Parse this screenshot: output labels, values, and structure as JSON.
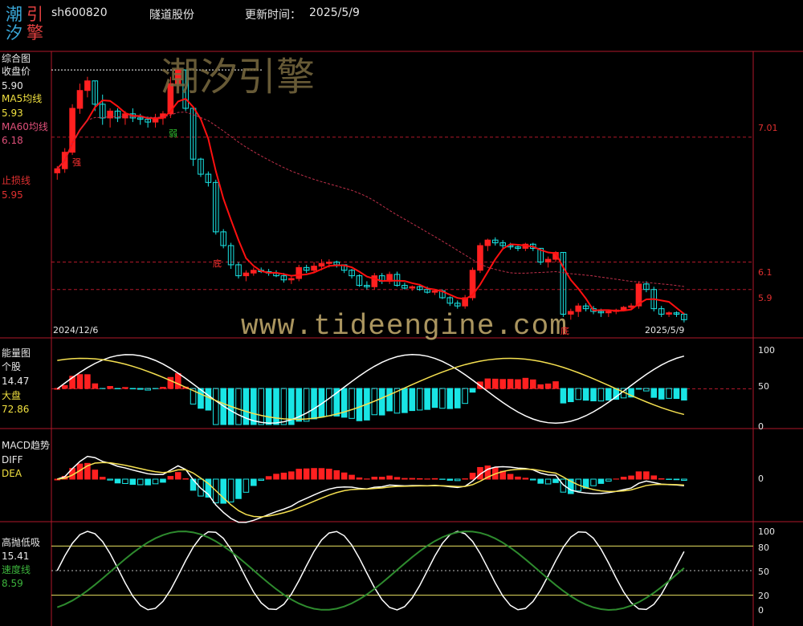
{
  "header": {
    "logo_chars": [
      "潮",
      "引",
      "汐",
      "擎"
    ],
    "code": "sh600820",
    "name": "隧道股份",
    "update_label": "更新时间：",
    "update_date": "2025/5/9"
  },
  "watermarks": {
    "brand": "潮汐引擎",
    "url": "www.tideengine.com"
  },
  "colors": {
    "up": "#ff2020",
    "down": "#19e5e5",
    "ma5": "#ff1010",
    "ma60": "#c0304a",
    "grid": "#b0182a",
    "white": "#ffffff",
    "yellow": "#f5e050",
    "green": "#2e8b2e"
  },
  "panels": {
    "main": {
      "title": "综合图",
      "close_label": "收盘价",
      "close_value": "5.90",
      "ma5_label": "MA5均线",
      "ma5_value": "5.93",
      "ma60_label": "MA60均线",
      "ma60_value": "6.18",
      "stop_label": "止损线",
      "stop_value": "5.95",
      "right_axis": [
        "7.01",
        "6.1",
        "5.9"
      ],
      "date_start": "2024/12/6",
      "date_end": "2025/5/9",
      "markers": [
        "强",
        "弱",
        "底",
        "底"
      ]
    },
    "energy": {
      "title": "能量图",
      "stock_label": "个股",
      "stock_value": "14.47",
      "market_label": "大盘",
      "market_value": "72.86",
      "right_axis": [
        "100",
        "50",
        "0"
      ]
    },
    "macd": {
      "title": "MACD趋势",
      "diff_label": "DIFF",
      "dea_label": "DEA",
      "right_axis": [
        "0"
      ]
    },
    "kd": {
      "title": "高抛低吸",
      "value": "15.41",
      "speed_label": "速度线",
      "speed_value": "8.59",
      "right_axis": [
        "100",
        "80",
        "50",
        "20",
        "0"
      ]
    }
  },
  "chart_data": [
    {
      "type": "candlestick",
      "title": "综合图",
      "x": [
        "2024/12/6",
        "2025/5/9"
      ],
      "candles": [
        [
          6.75,
          6.8,
          6.7,
          6.78
        ],
        [
          6.78,
          6.93,
          6.75,
          6.9
        ],
        [
          6.9,
          7.25,
          6.88,
          7.22
        ],
        [
          7.22,
          7.4,
          7.18,
          7.35
        ],
        [
          7.35,
          7.45,
          7.3,
          7.42
        ],
        [
          7.42,
          7.42,
          7.2,
          7.25
        ],
        [
          7.25,
          7.32,
          7.1,
          7.15
        ],
        [
          7.15,
          7.22,
          7.08,
          7.2
        ],
        [
          7.2,
          7.22,
          7.12,
          7.15
        ],
        [
          7.15,
          7.2,
          7.1,
          7.18
        ],
        [
          7.18,
          7.22,
          7.12,
          7.15
        ],
        [
          7.15,
          7.18,
          7.1,
          7.14
        ],
        [
          7.14,
          7.16,
          7.08,
          7.12
        ],
        [
          7.12,
          7.18,
          7.08,
          7.15
        ],
        [
          7.15,
          7.2,
          7.1,
          7.18
        ],
        [
          7.18,
          7.45,
          7.15,
          7.4
        ],
        [
          7.4,
          7.52,
          7.35,
          7.5
        ],
        [
          7.5,
          7.5,
          7.2,
          7.22
        ],
        [
          7.22,
          7.22,
          6.8,
          6.85
        ],
        [
          6.85,
          6.86,
          6.72,
          6.74
        ],
        [
          6.74,
          6.76,
          6.65,
          6.68
        ],
        [
          6.68,
          6.7,
          6.3,
          6.32
        ],
        [
          6.32,
          6.34,
          6.2,
          6.22
        ],
        [
          6.22,
          6.24,
          6.05,
          6.08
        ],
        [
          6.08,
          6.1,
          5.98,
          6.0
        ],
        [
          6.0,
          6.04,
          5.96,
          6.02
        ],
        [
          6.02,
          6.06,
          6.0,
          6.04
        ],
        [
          6.04,
          6.06,
          6.02,
          6.03
        ],
        [
          6.03,
          6.05,
          6.0,
          6.02
        ],
        [
          6.02,
          6.04,
          5.99,
          6.0
        ],
        [
          6.0,
          6.02,
          5.95,
          5.97
        ],
        [
          5.97,
          6.0,
          5.94,
          5.98
        ],
        [
          5.98,
          6.08,
          5.96,
          6.06
        ],
        [
          6.06,
          6.08,
          6.02,
          6.04
        ],
        [
          6.04,
          6.1,
          6.02,
          6.07
        ],
        [
          6.07,
          6.12,
          6.04,
          6.09
        ],
        [
          6.09,
          6.12,
          6.06,
          6.1
        ],
        [
          6.1,
          6.11,
          6.06,
          6.08
        ],
        [
          6.08,
          6.08,
          6.02,
          6.04
        ],
        [
          6.04,
          6.05,
          5.98,
          6.0
        ],
        [
          6.0,
          6.01,
          5.92,
          5.93
        ],
        [
          5.93,
          5.96,
          5.9,
          5.92
        ],
        [
          5.92,
          6.02,
          5.9,
          6.0
        ],
        [
          6.0,
          6.02,
          5.94,
          5.96
        ],
        [
          5.96,
          6.03,
          5.94,
          6.01
        ],
        [
          6.01,
          6.03,
          5.92,
          5.93
        ],
        [
          5.93,
          5.95,
          5.9,
          5.91
        ],
        [
          5.91,
          5.93,
          5.89,
          5.92
        ],
        [
          5.92,
          5.94,
          5.89,
          5.9
        ],
        [
          5.9,
          5.92,
          5.87,
          5.88
        ],
        [
          5.88,
          5.9,
          5.86,
          5.89
        ],
        [
          5.89,
          5.9,
          5.83,
          5.84
        ],
        [
          5.84,
          5.85,
          5.78,
          5.8
        ],
        [
          5.8,
          5.82,
          5.76,
          5.78
        ],
        [
          5.78,
          5.86,
          5.76,
          5.84
        ],
        [
          5.84,
          6.06,
          5.82,
          6.04
        ],
        [
          6.04,
          6.24,
          6.02,
          6.22
        ],
        [
          6.22,
          6.27,
          6.18,
          6.26
        ],
        [
          6.26,
          6.28,
          6.22,
          6.24
        ],
        [
          6.24,
          6.26,
          6.2,
          6.22
        ],
        [
          6.22,
          6.24,
          6.19,
          6.21
        ],
        [
          6.21,
          6.23,
          6.18,
          6.2
        ],
        [
          6.2,
          6.24,
          6.18,
          6.23
        ],
        [
          6.23,
          6.24,
          6.18,
          6.2
        ],
        [
          6.2,
          6.2,
          6.08,
          6.1
        ],
        [
          6.1,
          6.14,
          6.06,
          6.12
        ],
        [
          6.12,
          6.18,
          6.1,
          6.17
        ],
        [
          6.17,
          6.17,
          5.7,
          5.72
        ],
        [
          5.72,
          5.76,
          5.68,
          5.74
        ],
        [
          5.74,
          5.8,
          5.7,
          5.78
        ],
        [
          5.78,
          5.8,
          5.74,
          5.76
        ],
        [
          5.76,
          5.78,
          5.72,
          5.74
        ],
        [
          5.74,
          5.76,
          5.7,
          5.73
        ],
        [
          5.73,
          5.75,
          5.7,
          5.74
        ],
        [
          5.74,
          5.76,
          5.72,
          5.75
        ],
        [
          5.75,
          5.78,
          5.74,
          5.77
        ],
        [
          5.77,
          5.8,
          5.75,
          5.78
        ],
        [
          5.78,
          5.96,
          5.76,
          5.94
        ],
        [
          5.94,
          5.96,
          5.88,
          5.9
        ],
        [
          5.9,
          5.92,
          5.74,
          5.76
        ],
        [
          5.76,
          5.78,
          5.7,
          5.72
        ],
        [
          5.72,
          5.74,
          5.7,
          5.73
        ],
        [
          5.73,
          5.74,
          5.7,
          5.72
        ],
        [
          5.72,
          5.73,
          5.66,
          5.68
        ]
      ]
    }
  ]
}
